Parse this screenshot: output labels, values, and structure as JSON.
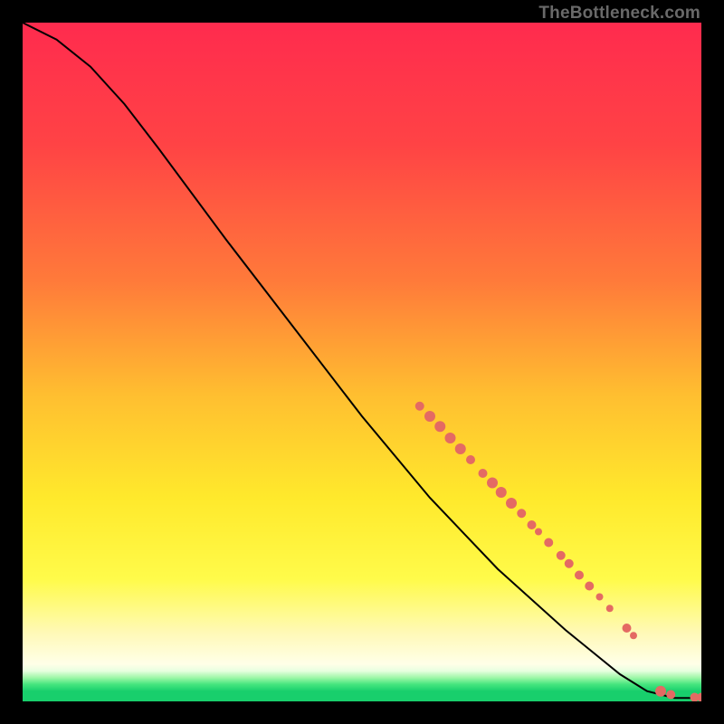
{
  "attribution": "TheBottleneck.com",
  "chart_data": {
    "type": "line",
    "title": "",
    "xlabel": "",
    "ylabel": "",
    "xlim": [
      0,
      100
    ],
    "ylim": [
      0,
      100
    ],
    "gradient_stops": [
      {
        "offset": 0.0,
        "color": "#ff2b4e"
      },
      {
        "offset": 0.18,
        "color": "#ff4345"
      },
      {
        "offset": 0.38,
        "color": "#ff7a3a"
      },
      {
        "offset": 0.55,
        "color": "#ffbf30"
      },
      {
        "offset": 0.7,
        "color": "#ffe92c"
      },
      {
        "offset": 0.82,
        "color": "#fffb4a"
      },
      {
        "offset": 0.9,
        "color": "#fff9b8"
      },
      {
        "offset": 0.945,
        "color": "#ffffe8"
      },
      {
        "offset": 0.955,
        "color": "#e8ffe0"
      },
      {
        "offset": 0.965,
        "color": "#9ff7a8"
      },
      {
        "offset": 0.975,
        "color": "#45e57e"
      },
      {
        "offset": 0.985,
        "color": "#18cf6c"
      },
      {
        "offset": 1.0,
        "color": "#18cf6c"
      }
    ],
    "curve_points": [
      {
        "x": 0.0,
        "y": 100.0
      },
      {
        "x": 5.0,
        "y": 97.5
      },
      {
        "x": 10.0,
        "y": 93.5
      },
      {
        "x": 15.0,
        "y": 88.0
      },
      {
        "x": 20.0,
        "y": 81.5
      },
      {
        "x": 30.0,
        "y": 68.0
      },
      {
        "x": 40.0,
        "y": 55.0
      },
      {
        "x": 50.0,
        "y": 42.0
      },
      {
        "x": 60.0,
        "y": 30.0
      },
      {
        "x": 70.0,
        "y": 19.5
      },
      {
        "x": 80.0,
        "y": 10.5
      },
      {
        "x": 88.0,
        "y": 4.0
      },
      {
        "x": 92.0,
        "y": 1.5
      },
      {
        "x": 96.0,
        "y": 0.5
      },
      {
        "x": 100.0,
        "y": 0.5
      }
    ],
    "markers": [
      {
        "x": 58.5,
        "y": 43.5,
        "r": 5
      },
      {
        "x": 60.0,
        "y": 42.0,
        "r": 6
      },
      {
        "x": 61.5,
        "y": 40.5,
        "r": 6
      },
      {
        "x": 63.0,
        "y": 38.8,
        "r": 6
      },
      {
        "x": 64.5,
        "y": 37.2,
        "r": 6
      },
      {
        "x": 66.0,
        "y": 35.6,
        "r": 5
      },
      {
        "x": 67.8,
        "y": 33.6,
        "r": 5
      },
      {
        "x": 69.2,
        "y": 32.2,
        "r": 6
      },
      {
        "x": 70.5,
        "y": 30.8,
        "r": 6
      },
      {
        "x": 72.0,
        "y": 29.2,
        "r": 6
      },
      {
        "x": 73.5,
        "y": 27.7,
        "r": 5
      },
      {
        "x": 75.0,
        "y": 26.0,
        "r": 5
      },
      {
        "x": 76.0,
        "y": 25.0,
        "r": 4
      },
      {
        "x": 77.5,
        "y": 23.4,
        "r": 5
      },
      {
        "x": 79.3,
        "y": 21.5,
        "r": 5
      },
      {
        "x": 80.5,
        "y": 20.3,
        "r": 5
      },
      {
        "x": 82.0,
        "y": 18.6,
        "r": 5
      },
      {
        "x": 83.5,
        "y": 17.0,
        "r": 5
      },
      {
        "x": 85.0,
        "y": 15.4,
        "r": 4
      },
      {
        "x": 86.5,
        "y": 13.7,
        "r": 4
      },
      {
        "x": 89.0,
        "y": 10.8,
        "r": 5
      },
      {
        "x": 90.0,
        "y": 9.7,
        "r": 4
      },
      {
        "x": 94.0,
        "y": 1.5,
        "r": 6
      },
      {
        "x": 95.5,
        "y": 1.0,
        "r": 5
      },
      {
        "x": 99.0,
        "y": 0.6,
        "r": 5
      },
      {
        "x": 100.0,
        "y": 0.6,
        "r": 5
      }
    ],
    "marker_color": "#e46a63",
    "curve_color": "#000000",
    "curve_width": 2
  }
}
